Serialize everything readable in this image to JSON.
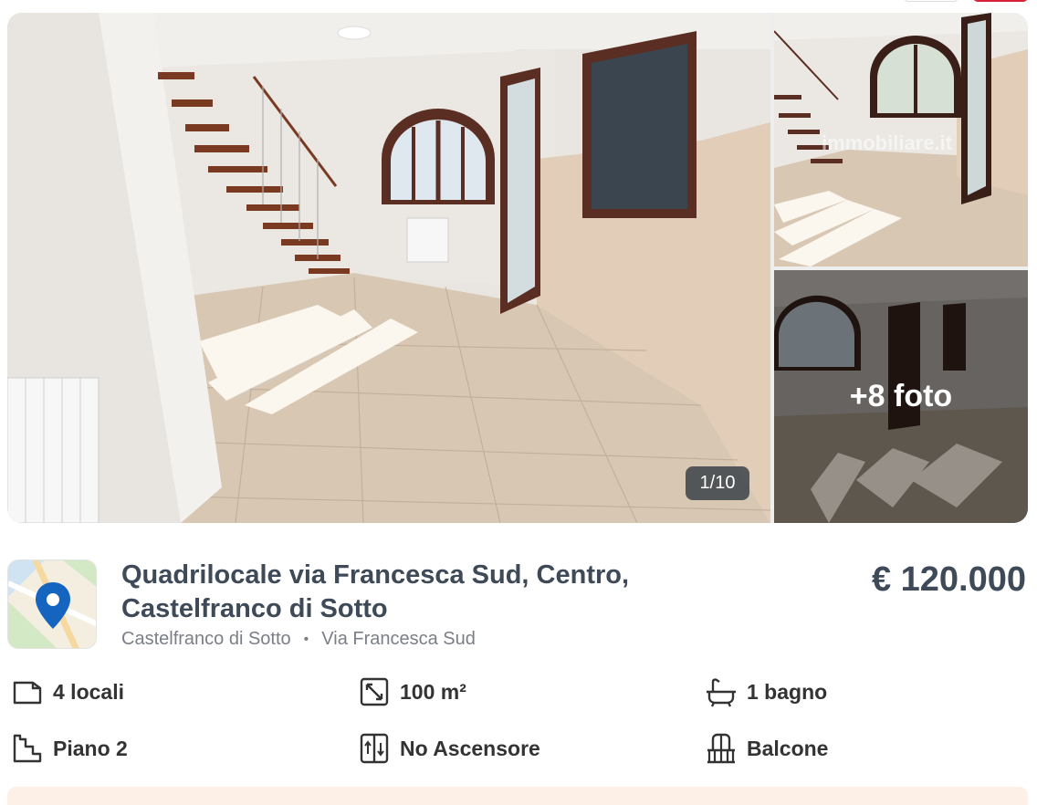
{
  "gallery": {
    "counter": "1/10",
    "more_photos": "+8 foto",
    "watermark": "immobiliare.it"
  },
  "listing": {
    "title": "Quadrilocale via Francesca Sud, Centro, Castelfranco di Sotto",
    "location_city": "Castelfranco di Sotto",
    "location_separator": "•",
    "location_street": "Via Francesca Sud",
    "price": "€ 120.000"
  },
  "features": [
    {
      "icon": "rooms-icon",
      "label": "4 locali"
    },
    {
      "icon": "surface-icon",
      "label": "100 m²"
    },
    {
      "icon": "bathtub-icon",
      "label": "1 bagno"
    },
    {
      "icon": "stairs-icon",
      "label": "Piano 2"
    },
    {
      "icon": "elevator-icon",
      "label": "No Ascensore"
    },
    {
      "icon": "balcony-icon",
      "label": "Balcone"
    }
  ],
  "colors": {
    "title": "#3f4a58",
    "accent_red": "#d9223a",
    "map_pin": "#1565c0"
  }
}
